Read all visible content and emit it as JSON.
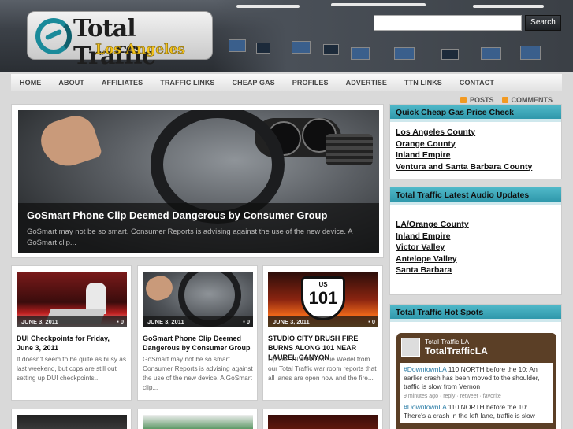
{
  "header": {
    "logo_line1": "Total Traffic",
    "logo_line2": "Los Angeles",
    "search_placeholder": "",
    "search_button": "Search"
  },
  "nav": [
    "HOME",
    "ABOUT",
    "AFFILIATES",
    "TRAFFIC LINKS",
    "CHEAP GAS",
    "PROFILES",
    "ADVERTISE",
    "TTN LINKS",
    "CONTACT"
  ],
  "feeds": {
    "posts": "POSTS",
    "comments": "COMMENTS"
  },
  "featured": {
    "title": "GoSmart Phone Clip Deemed Dangerous by Consumer Group",
    "excerpt": "GoSmart may not be so smart. Consumer Reports is advising against the use of the new device. A GoSmart clip..."
  },
  "posts": [
    {
      "date": "JUNE 3, 2011",
      "comments": "0",
      "title": "DUI Checkpoints for Friday, June 3, 2011",
      "excerpt": "It doesn't seem to be quite as busy as last weekend, but cops are still out setting up DUI checkpoints..."
    },
    {
      "date": "JUNE 3, 2011",
      "comments": "0",
      "title": "GoSmart Phone Clip Deemed Dangerous by Consumer Group",
      "excerpt": "GoSmart may not be so smart. Consumer Reports is advising against the use of the new device. A GoSmart clip..."
    },
    {
      "date": "JUNE 3, 2011",
      "comments": "0",
      "title": "STUDIO CITY BRUSH FIRE BURNS ALONG 101 NEAR LAUREL CANYON",
      "excerpt": "Update 10:49am Rosie Wedel from our Total Traffic war room reports that all lanes are open now and the fire...",
      "sign_top": "US",
      "sign_num": "101"
    }
  ],
  "sidebar": {
    "gas": {
      "title": "Quick Cheap Gas Price Check",
      "links": [
        "Los Angeles County",
        "Orange County",
        "Inland Empire",
        "Ventura and Santa Barbara County"
      ]
    },
    "audio": {
      "title": "Total Traffic Latest Audio Updates",
      "links": [
        "LA/Orange County",
        "Inland Empire",
        "Victor Valley",
        "Antelope Valley",
        "Santa Barbara"
      ]
    },
    "hotspots": {
      "title": "Total Traffic Hot Spots",
      "account_name": "Total Traffic LA",
      "handle": "TotalTrafficLA",
      "tweets": [
        {
          "tag": "#DowntownLA",
          "text": " 110 NORTH before the 10: An earlier crash has been moved to the shoulder, traffic is slow from Vernon",
          "time": "9 minutes ago · reply · retweet · favorite"
        },
        {
          "tag": "#DowntownLA",
          "text": " 110 NORTH before the 10: There's a crash in the left lane, traffic is slow",
          "time": ""
        }
      ]
    }
  }
}
